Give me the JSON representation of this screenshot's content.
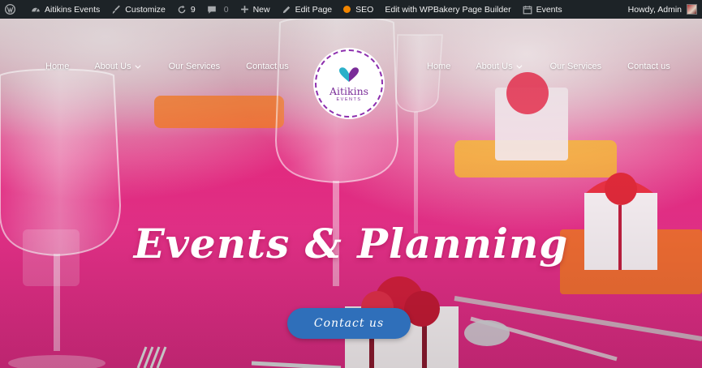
{
  "adminbar": {
    "site_name": "Aitikins Events",
    "customize": "Customize",
    "updates_count": "9",
    "comments_count": "0",
    "new_label": "New",
    "edit_page": "Edit Page",
    "seo": "SEO",
    "wpbakery": "Edit with WPBakery Page Builder",
    "events": "Events",
    "howdy": "Howdy, Admin"
  },
  "nav_left": {
    "home": "Home",
    "about": "About Us",
    "services": "Our Services",
    "contact": "Contact us"
  },
  "nav_right": {
    "home": "Home",
    "about": "About Us",
    "services": "Our Services",
    "contact": "Contact us"
  },
  "logo": {
    "name": "Aitikins",
    "sub": "EVENTS"
  },
  "hero": {
    "title": "Events & Planning",
    "cta": "Contact us"
  },
  "colors": {
    "adminbar_bg": "#1d2327",
    "accent_pink": "#e8318a",
    "cta_blue": "#2f6fba",
    "logo_purple": "#7a2c98"
  }
}
